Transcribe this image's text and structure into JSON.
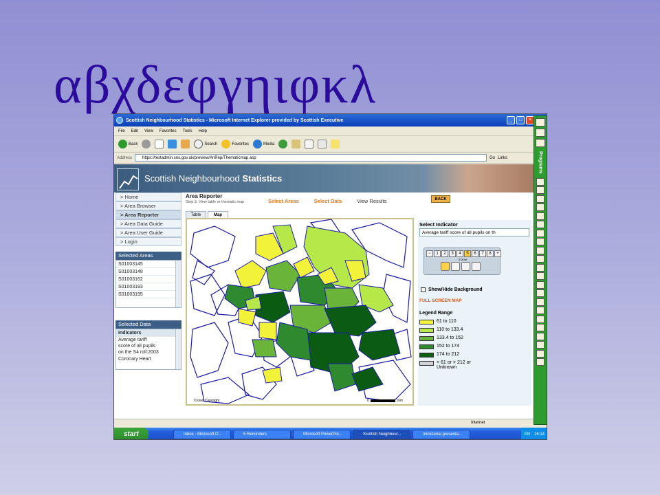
{
  "slide": {
    "title": "αβχδεφγηιφκλ"
  },
  "window": {
    "title": "Scottish Neighbourhood Statistics - Microsoft Internet Explorer provided by Scottish Executive"
  },
  "menu": [
    "File",
    "Edit",
    "View",
    "Favorites",
    "Tools",
    "Help"
  ],
  "toolbar": {
    "back": "Back",
    "search": "Search",
    "favorites": "Favorites",
    "media": "Media"
  },
  "address": {
    "label": "Address",
    "url": "https://testadmin.sns.gov.uk/preview/AnRep/Thematicmap.asp",
    "go": "Go",
    "links": "Links"
  },
  "site": {
    "title_plain": "Scottish Neighbourhood ",
    "title_bold": "Statistics"
  },
  "nav": [
    "> Home",
    "> Area Browser",
    "> Area Reporter",
    "> Area Data Guide",
    "> Area User Guide",
    "> Login"
  ],
  "selected_areas": {
    "heading": "Selected Areas",
    "items": [
      "S01003145",
      "S01003148",
      "S01003162",
      "S01003193",
      "S01003195"
    ]
  },
  "selected_data": {
    "heading": "Selected Data",
    "indicators": "Indicators",
    "text1": "Average tariff",
    "text2": "score of all pupils",
    "text3": "on the S4 roll:2003",
    "text4": "Coronary Heart"
  },
  "reporter": {
    "title": "Area Reporter",
    "step": "Step 3. View table or thematic map",
    "crumbs": [
      "Select Areas",
      "Select Data",
      "View Results"
    ],
    "back": "BACK"
  },
  "tabs": [
    "Table",
    "Map"
  ],
  "map": {
    "copyright": "Crown Copyright",
    "scale_start": "0",
    "scale_end": "1km"
  },
  "indicator": {
    "heading": "Select Indicator",
    "value": "Average tariff score of all pupils on th",
    "zoom": "ZOOM"
  },
  "controls": {
    "show_hide": "Show/Hide Background",
    "full_screen": "FULL SCREEN MAP",
    "legend_heading": "Legend Range"
  },
  "legend": [
    {
      "label": "61 to 110",
      "color": "#f2f23a"
    },
    {
      "label": "110 to 133.4",
      "color": "#b7e84a"
    },
    {
      "label": "133.4 to 152",
      "color": "#6ab43a"
    },
    {
      "label": "152 to 174",
      "color": "#2f8a2f"
    },
    {
      "label": "174 to 212",
      "color": "#0b5c12"
    },
    {
      "label": "< 61 or > 212 or",
      "label2": "Unknown",
      "color": "#cfd3d6"
    }
  ],
  "status": {
    "zone": "Internet"
  },
  "taskbar": {
    "start": "start",
    "tasks": [
      "Inbox - Microsoft O...",
      "5 Reminders",
      "Microsoft PowerPoi...",
      "Scottish Neighbour...",
      "ministerial presenta..."
    ],
    "lang": "EN",
    "time": "16:14"
  },
  "office_bar": {
    "label": "Programs"
  }
}
